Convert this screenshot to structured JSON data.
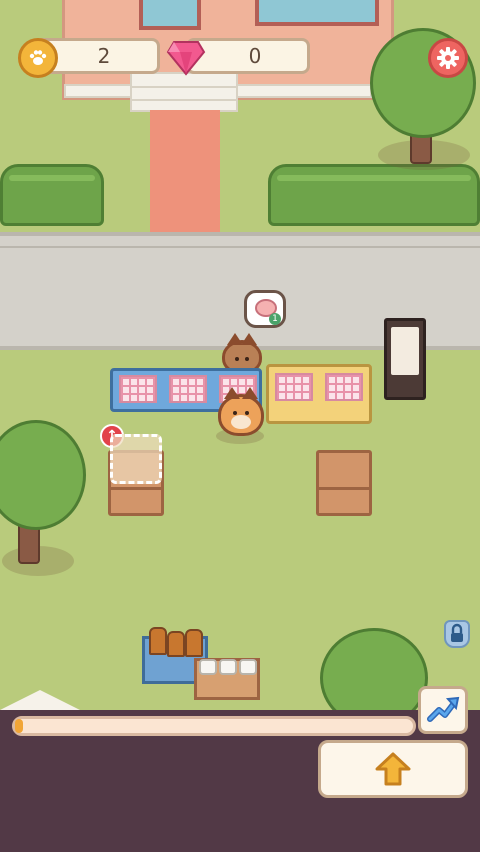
{
  "hud": {
    "coins": "2",
    "gems": "0"
  },
  "order_bubble": {
    "count": "1"
  },
  "progress": {
    "fraction": 0.02
  },
  "colors": {
    "grass": "#b9cb7c",
    "panel": "#523946",
    "progress_fill": "#f1a536",
    "accent_red": "#ee6561"
  },
  "icons": {
    "currency": "paw-coin-icon",
    "premium": "gem-icon",
    "settings": "gear-icon",
    "stats": "chart-arrow-icon",
    "upgrade": "up-arrow-icon",
    "locked": "lock-icon",
    "add_station": "red-up-arrow-icon"
  }
}
